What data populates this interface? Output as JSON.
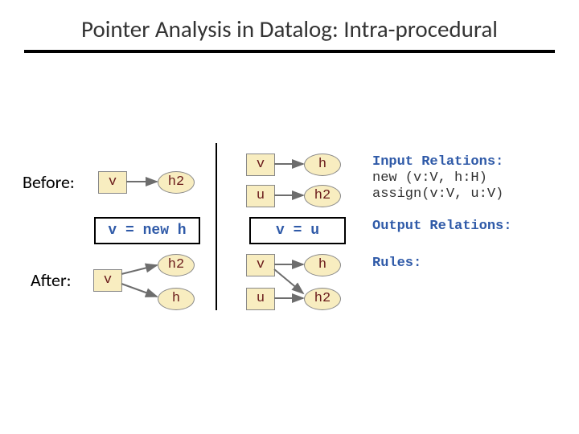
{
  "title": "Pointer Analysis in Datalog: Intra-procedural",
  "labels": {
    "before": "Before:",
    "after": "After:"
  },
  "col1": {
    "before": {
      "v": "v",
      "h2": "h2"
    },
    "stmt": "v = new h",
    "after": {
      "v": "v",
      "h2": "h2",
      "h": "h"
    }
  },
  "col2": {
    "before": {
      "v": "v",
      "h": "h",
      "u": "u",
      "h2": "h2"
    },
    "stmt": "v = u",
    "after": {
      "v": "v",
      "h": "h",
      "u": "u",
      "h2": "h2"
    }
  },
  "legend": {
    "input_title": "Input Relations:",
    "input_line1": "new   (v:V, h:H)",
    "input_line2": "assign(v:V, u:V)",
    "output_title": "Output Relations:",
    "rules_title": "Rules:"
  }
}
